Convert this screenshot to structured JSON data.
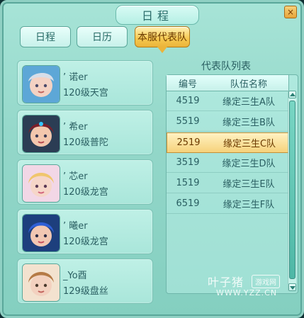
{
  "window": {
    "title": "日程",
    "close_symbol": "×"
  },
  "tabs": [
    {
      "label": "日程",
      "active": false
    },
    {
      "label": "日历",
      "active": false
    },
    {
      "label": "本服代表队",
      "active": true
    }
  ],
  "players": [
    {
      "name": "’ 诺er",
      "level": "120级天宫",
      "avatar_icon": "female-hero-silver-hair"
    },
    {
      "name": "’ 希er",
      "level": "120级普陀",
      "avatar_icon": "female-hero-red-hair"
    },
    {
      "name": "’ 芯er",
      "level": "120级龙宫",
      "avatar_icon": "female-hero-blonde"
    },
    {
      "name": "’ 曦er",
      "level": "120级龙宫",
      "avatar_icon": "female-hero-blue-hair"
    },
    {
      "name": "_Yo酉",
      "level": "129级盘丝",
      "avatar_icon": "female-hero-brown-hair"
    }
  ],
  "teams": {
    "title": "代表队列表",
    "headers": [
      "编号",
      "队伍名称"
    ],
    "rows": [
      {
        "id": "4519",
        "name": "缘定三生A队",
        "selected": false
      },
      {
        "id": "5519",
        "name": "缘定三生B队",
        "selected": false
      },
      {
        "id": "2519",
        "name": "缘定三生C队",
        "selected": true
      },
      {
        "id": "3519",
        "name": "缘定三生D队",
        "selected": false
      },
      {
        "id": "1519",
        "name": "缘定三生E队",
        "selected": false
      },
      {
        "id": "6519",
        "name": "缘定三生F队",
        "selected": false
      }
    ]
  },
  "watermark": {
    "brand": "叶子猪",
    "tag": "游戏网",
    "url": "WWW.YZZ.CN"
  }
}
